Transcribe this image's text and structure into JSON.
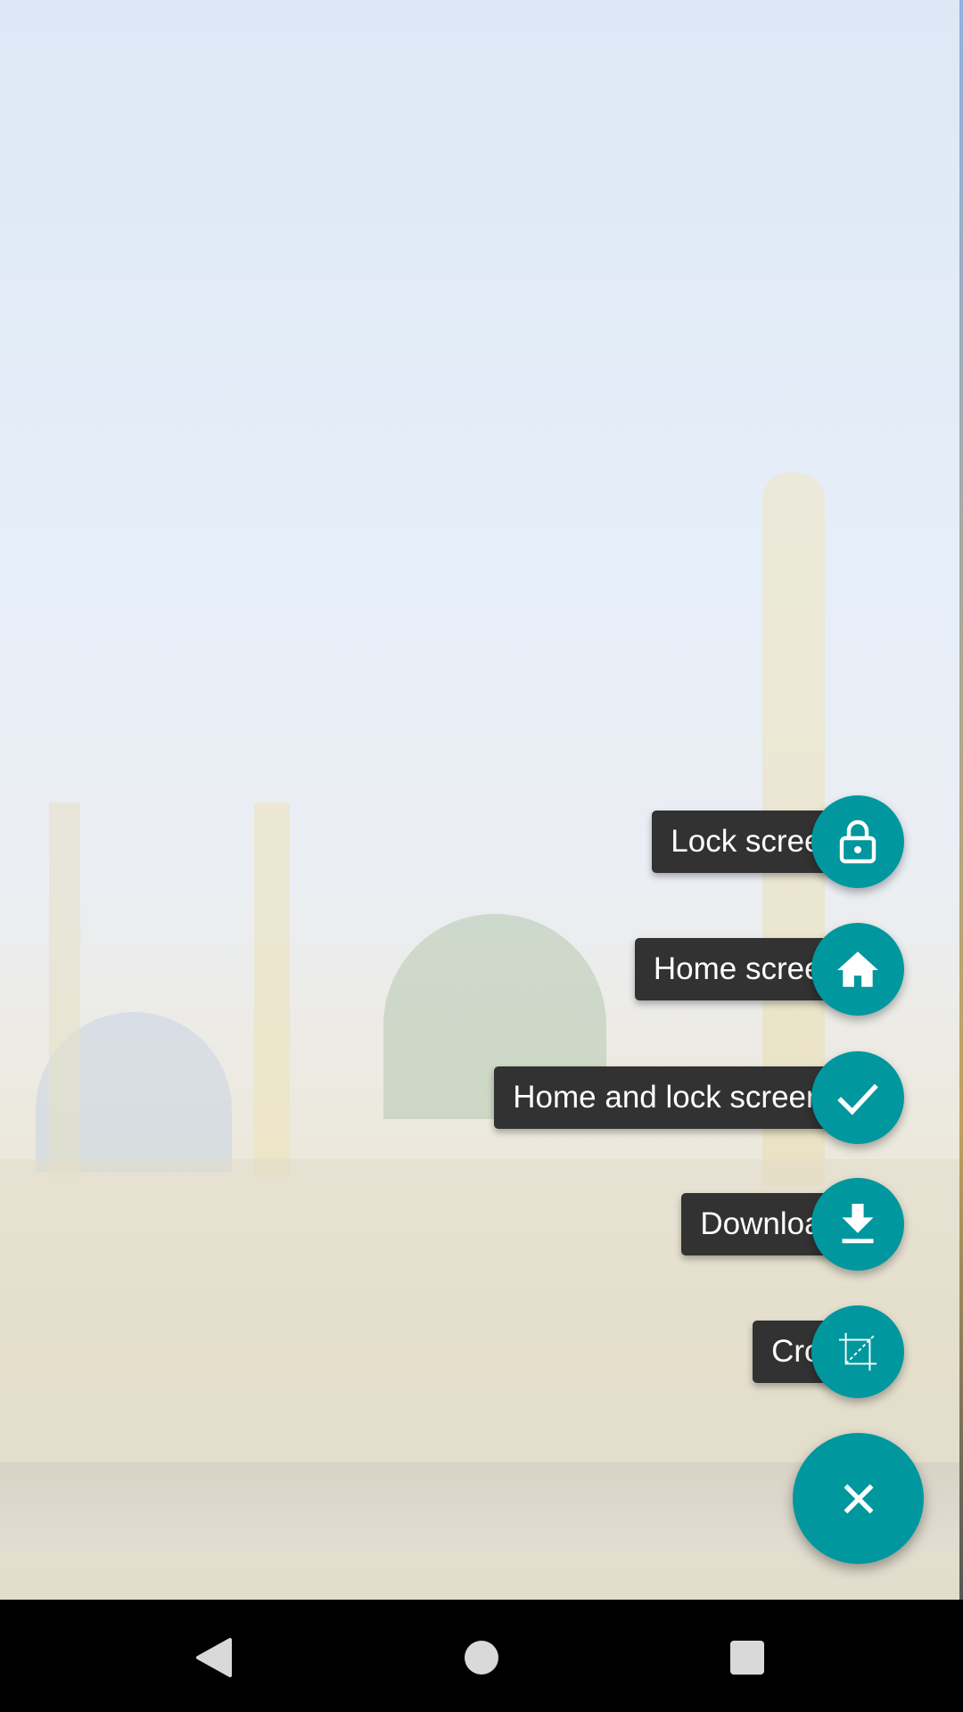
{
  "menu": {
    "items": [
      {
        "label": "Lock screen",
        "icon": "lock-icon"
      },
      {
        "label": "Home screen",
        "icon": "home-icon"
      },
      {
        "label": "Home and lock screens",
        "icon": "check-icon"
      },
      {
        "label": "Download",
        "icon": "download-icon"
      },
      {
        "label": "Crop",
        "icon": "crop-icon"
      }
    ],
    "close_icon": "close-icon"
  },
  "colors": {
    "accent": "#00979f",
    "label_bg": "#323232"
  },
  "navbar": {
    "back": "back-icon",
    "home": "home-circle-icon",
    "recents": "recents-icon"
  }
}
